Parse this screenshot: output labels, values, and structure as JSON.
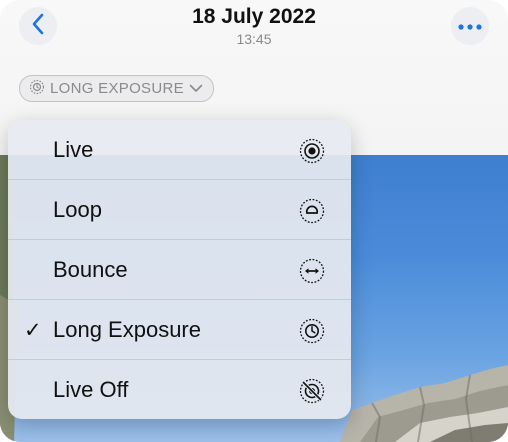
{
  "header": {
    "date": "18 July 2022",
    "time": "13:45"
  },
  "mode_pill": {
    "label": "LONG EXPOSURE",
    "icon": "long-exposure-icon"
  },
  "menu": {
    "items": [
      {
        "label": "Live",
        "icon": "live-icon",
        "selected": false
      },
      {
        "label": "Loop",
        "icon": "loop-icon",
        "selected": false
      },
      {
        "label": "Bounce",
        "icon": "bounce-icon",
        "selected": false
      },
      {
        "label": "Long Exposure",
        "icon": "long-exposure-icon",
        "selected": true
      },
      {
        "label": "Live Off",
        "icon": "live-off-icon",
        "selected": false
      }
    ],
    "check_glyph": "✓"
  },
  "colors": {
    "accent": "#1a73e8",
    "sky": "#4a8bd9"
  }
}
